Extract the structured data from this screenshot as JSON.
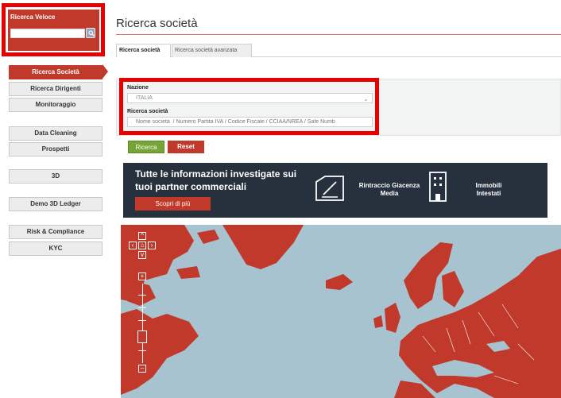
{
  "quick_search": {
    "title": "Ricerca Veloce",
    "placeholder": ""
  },
  "sidebar": {
    "items": [
      {
        "label": "Ricerca Società",
        "active": true
      },
      {
        "label": "Ricerca Dirigenti"
      },
      {
        "label": "Monitoraggio"
      },
      {
        "label": "Data Cleaning"
      },
      {
        "label": "Prospetti"
      },
      {
        "label": "3D"
      },
      {
        "label": "Demo 3D Ledger"
      },
      {
        "label": "Risk & Compliance"
      },
      {
        "label": "KYC"
      }
    ]
  },
  "page": {
    "title": "Ricerca società"
  },
  "tabs": [
    {
      "label": "Ricerca società",
      "active": true
    },
    {
      "label": "Ricerca società avanzata"
    }
  ],
  "form": {
    "country_label": "Nazione",
    "country_value": "ITALIA",
    "company_label": "Ricerca società",
    "company_placeholder": "Nome società  / Numero Partita IVA / Codice Fiscale / CCIAA/NREA / Safe Numb",
    "search_button": "Ricerca",
    "reset_button": "Reset"
  },
  "banner": {
    "headline": "Tutte le informazioni investigate sui tuoi partner commerciali",
    "cta": "Scopri di più",
    "feature1": "Rintraccio Giacenza Media",
    "feature2": "Immobili Intestati"
  },
  "colors": {
    "brand_red": "#c0392b",
    "highlight": "#e60000",
    "banner_bg": "#26313d",
    "search_green": "#76a535"
  }
}
